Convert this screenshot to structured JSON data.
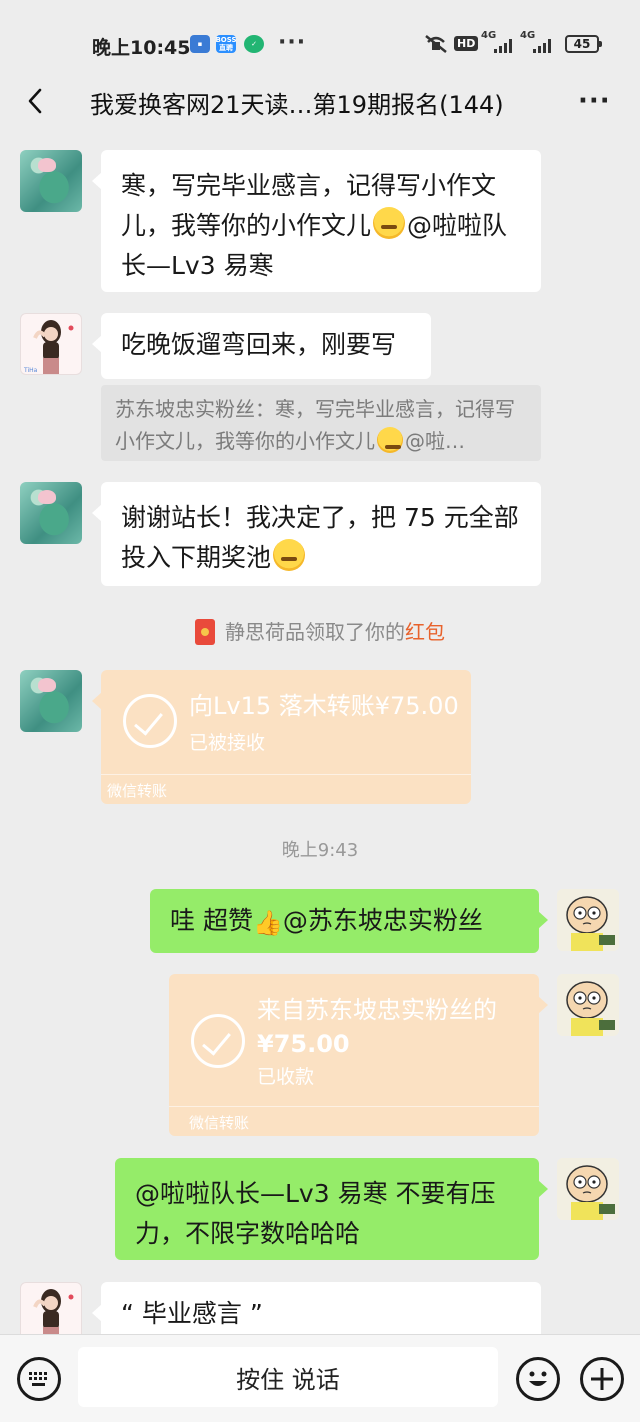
{
  "status_bar": {
    "time": "晚上10:45",
    "app_badge_boss": "BOSS直聘",
    "more_dots": "···",
    "hd": "HD",
    "net1": "4G",
    "net2": "4G",
    "battery": "45"
  },
  "header": {
    "title": "我爱换客网21天读…第19期报名(144)",
    "more": "···"
  },
  "messages": {
    "m1": {
      "side": "left",
      "text_a": "寒，写完毕业感言，记得写小作文儿，我等你的小作文儿",
      "text_b": "@啦啦队长—Lv3 易寒"
    },
    "m2": {
      "side": "left",
      "text": "吃晚饭遛弯回来，刚要写",
      "quote_a": "苏东坡忠实粉丝：寒，写完毕业感言，记得写小作文儿，我等你的小作文儿",
      "quote_b": "@啦…"
    },
    "m3": {
      "side": "left",
      "text_a": "谢谢站长！我决定了，把 75 元全部投入下期奖池"
    },
    "system_note": {
      "text_a": "静思荷品领取了你的",
      "text_red": "红包"
    },
    "transfer1": {
      "title": "向Lv15 落木转账¥75.00",
      "status": "已被接收",
      "footer": "微信转账"
    },
    "time_divider": "晚上9:43",
    "m4": {
      "side": "right",
      "text_a": "哇 超赞",
      "text_b": "@苏东坡忠实粉丝"
    },
    "transfer2": {
      "title_a": "来自苏东坡忠实粉丝的",
      "title_b": "¥75.00",
      "status": "已收款",
      "footer": "微信转账"
    },
    "m5": {
      "side": "right",
      "text": "@啦啦队长—Lv3 易寒  不要有压力，不限字数哈哈哈"
    },
    "m6": {
      "side": "left",
      "text": "“ 毕业感言 ”"
    }
  },
  "input_bar": {
    "hold_to_talk": "按住 说话",
    "keyboard_icon": "keyboard-icon",
    "emoji_icon": "emoji-icon",
    "plus_icon": "plus-icon"
  },
  "colors": {
    "background": "#ededed",
    "bubble_right": "#95ec69",
    "bubble_left": "#ffffff",
    "transfer": "#fbe1c3",
    "red_packet_link": "#e8622c"
  }
}
